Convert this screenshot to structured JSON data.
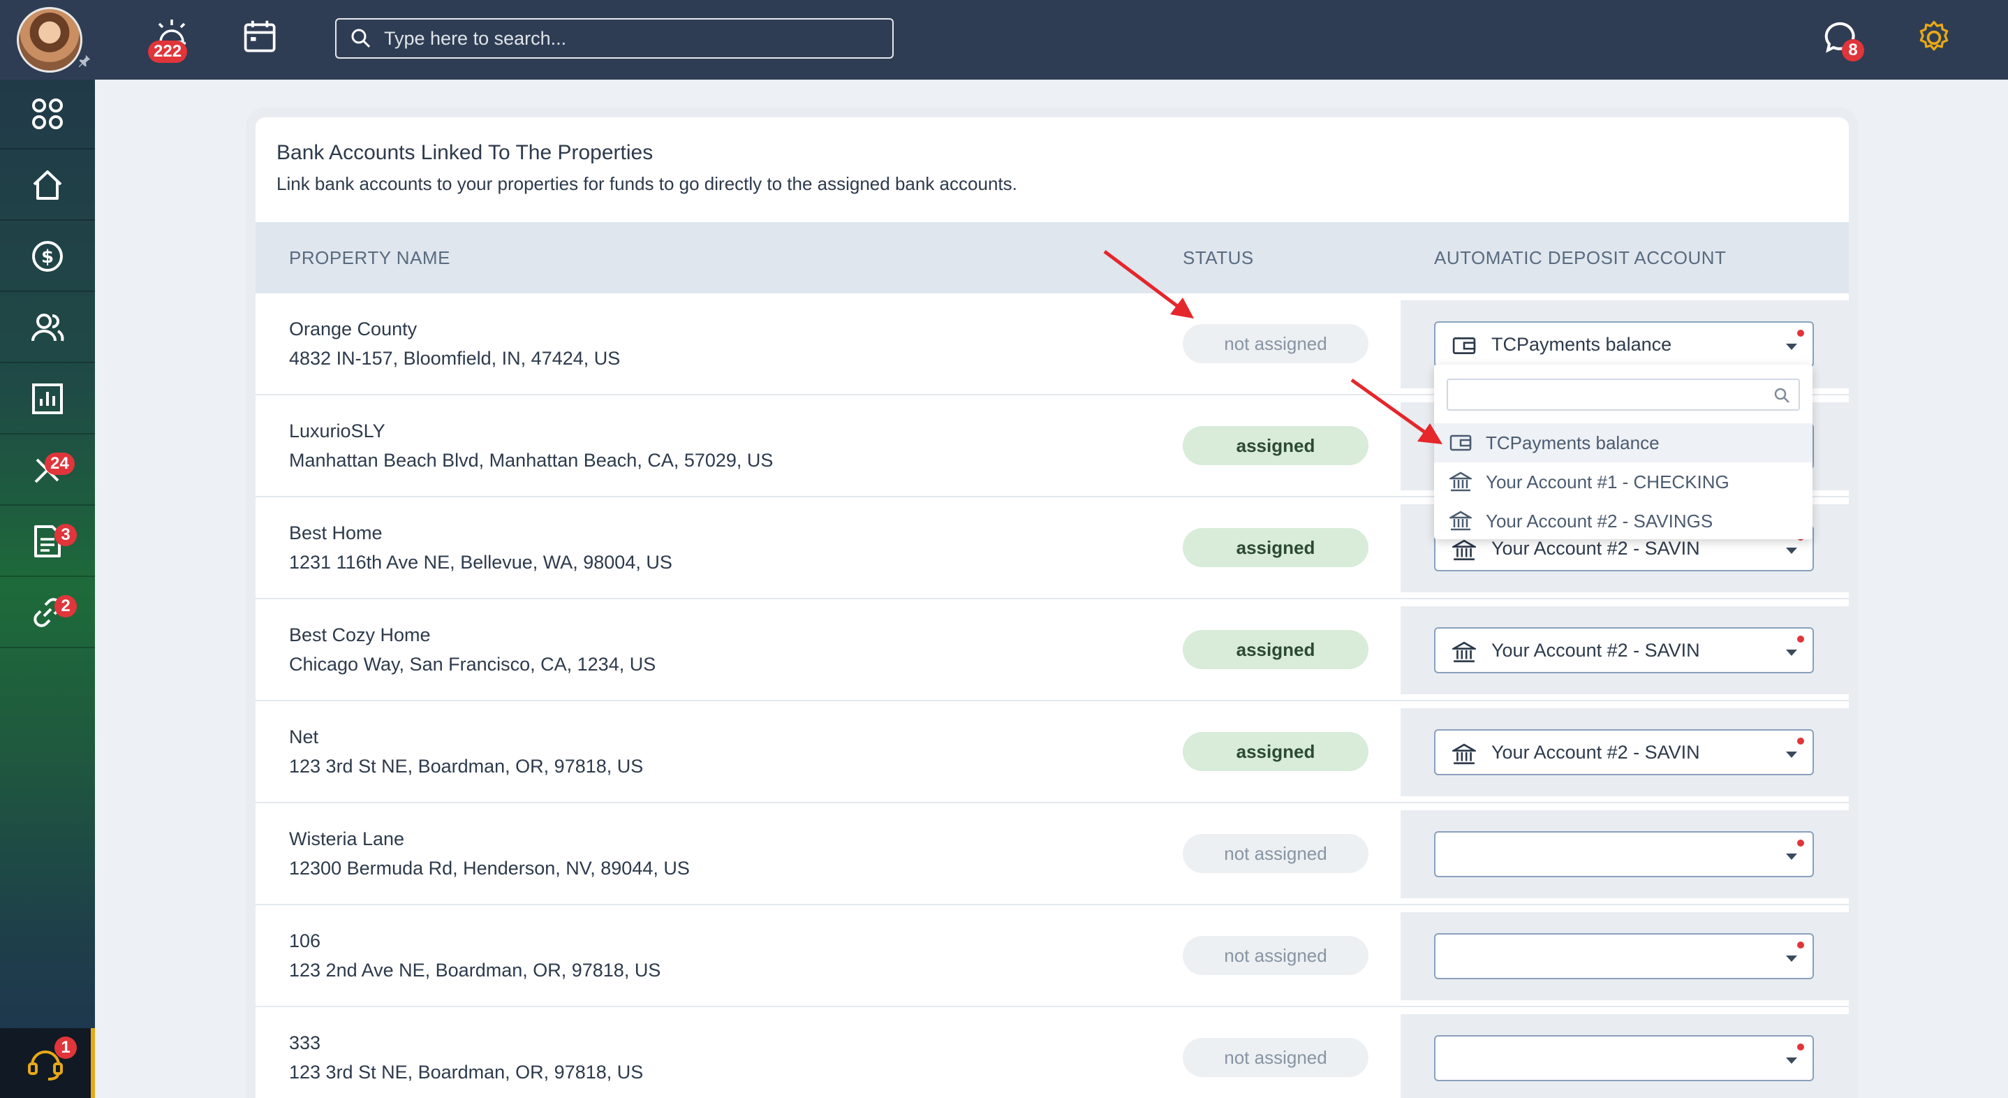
{
  "topbar": {
    "notifications_badge": "222",
    "search_placeholder": "Type here to search...",
    "chat_badge": "8"
  },
  "sidebar": {
    "items": [
      {
        "icon": "apps-icon"
      },
      {
        "icon": "home-icon"
      },
      {
        "icon": "dollar-icon"
      },
      {
        "icon": "users-icon"
      },
      {
        "icon": "chart-icon"
      },
      {
        "icon": "tools-icon",
        "badge": "24"
      },
      {
        "icon": "document-icon",
        "badge": "3"
      },
      {
        "icon": "link-icon",
        "badge": "2"
      }
    ],
    "support_badge": "1"
  },
  "card": {
    "title": "Bank Accounts Linked To The Properties",
    "subtitle": "Link bank accounts to your properties for funds to go directly to the assigned bank accounts."
  },
  "table": {
    "headers": [
      "PROPERTY NAME",
      "STATUS",
      "AUTOMATIC DEPOSIT ACCOUNT"
    ],
    "rows": [
      {
        "name": "Orange County",
        "address": "4832 IN-157, Bloomfield, IN, 47424, US",
        "status": "not assigned",
        "account": "TCPayments balance",
        "account_icon": "wallet-icon"
      },
      {
        "name": "LuxurioSLY",
        "address": "Manhattan Beach Blvd, Manhattan Beach, CA, 57029, US",
        "status": "assigned",
        "account": "",
        "account_icon": ""
      },
      {
        "name": "Best Home",
        "address": "1231 116th Ave NE, Bellevue, WA, 98004, US",
        "status": "assigned",
        "account": "Your Account #2 - SAVIN",
        "account_icon": "bank-icon"
      },
      {
        "name": "Best Cozy Home",
        "address": "Chicago Way, San Francisco, CA, 1234, US",
        "status": "assigned",
        "account": "Your Account #2 - SAVIN",
        "account_icon": "bank-icon"
      },
      {
        "name": "Net",
        "address": "123 3rd St NE, Boardman, OR, 97818, US",
        "status": "assigned",
        "account": "Your Account #2 - SAVIN",
        "account_icon": "bank-icon"
      },
      {
        "name": "Wisteria Lane",
        "address": "12300 Bermuda Rd, Henderson, NV, 89044, US",
        "status": "not assigned",
        "account": "",
        "account_icon": ""
      },
      {
        "name": "106",
        "address": "123 2nd Ave NE, Boardman, OR, 97818, US",
        "status": "not assigned",
        "account": "",
        "account_icon": ""
      },
      {
        "name": "333",
        "address": "123 3rd St NE, Boardman, OR, 97818, US",
        "status": "not assigned",
        "account": "",
        "account_icon": ""
      }
    ]
  },
  "dropdown": {
    "search_value": "",
    "options": [
      {
        "label": "TCPayments balance",
        "icon": "wallet-icon",
        "active": true
      },
      {
        "label": "Your Account #1 - CHECKING",
        "icon": "bank-icon",
        "active": false
      },
      {
        "label": "Your Account #2 - SAVINGS",
        "icon": "bank-icon",
        "active": false
      }
    ]
  },
  "colors": {
    "topbar": "#2f3d54",
    "badge": "#e0353a",
    "assigned_bg": "#d8ecd9",
    "not_assigned_bg": "#edf0f3",
    "annotation_arrow": "#e5262b",
    "settings_icon": "#e8a917"
  }
}
